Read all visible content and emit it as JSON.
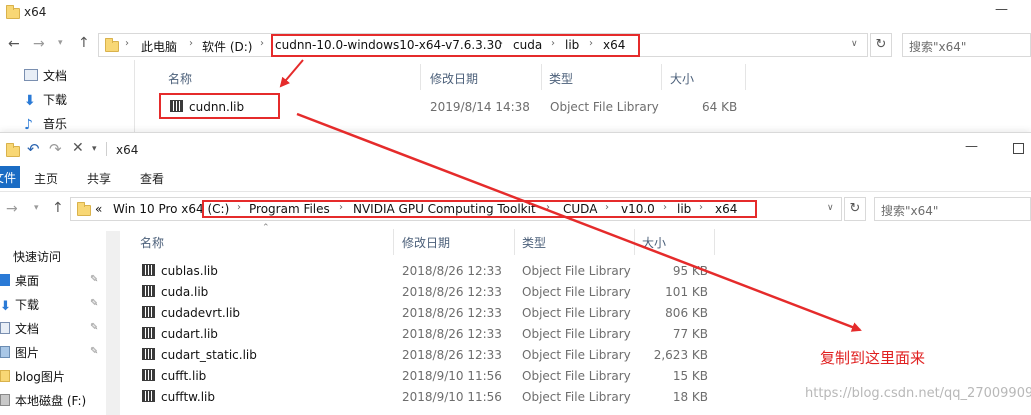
{
  "win1": {
    "title": "x64",
    "breadcrumbs": [
      "此电脑",
      "软件 (D:)",
      "cudnn-10.0-windows10-x64-v7.6.3.30",
      "cuda",
      "lib",
      "x64"
    ],
    "search_placeholder": "搜索\"x64\"",
    "sidebar": [
      {
        "label": "文档",
        "icon": "document-icon"
      },
      {
        "label": "下载",
        "icon": "download-arrow-icon"
      },
      {
        "label": "音乐",
        "icon": "music-note-icon"
      }
    ],
    "columns": {
      "name": "名称",
      "date": "修改日期",
      "type": "类型",
      "size": "大小"
    },
    "files": [
      {
        "name": "cudnn.lib",
        "date": "2019/8/14 14:38",
        "type": "Object File Library",
        "size": "64 KB"
      }
    ]
  },
  "win2": {
    "title": "x64",
    "ribbon": {
      "file": "文件",
      "home": "主页",
      "share": "共享",
      "view": "查看"
    },
    "breadcrumbs": [
      "«",
      "Win 10 Pro x64 (C:)",
      "Program Files",
      "NVIDIA GPU Computing Toolkit",
      "CUDA",
      "v10.0",
      "lib",
      "x64"
    ],
    "search_placeholder": "搜索\"x64\"",
    "sidebar": [
      {
        "label": "快速访问",
        "icon": "star-icon"
      },
      {
        "label": "桌面",
        "icon": "desktop-icon"
      },
      {
        "label": "下载",
        "icon": "download-arrow-icon"
      },
      {
        "label": "文档",
        "icon": "document-icon"
      },
      {
        "label": "图片",
        "icon": "picture-icon"
      },
      {
        "label": "blog图片",
        "icon": "folder-icon"
      },
      {
        "label": "本地磁盘 (F:)",
        "icon": "drive-icon"
      }
    ],
    "columns": {
      "name": "名称",
      "date": "修改日期",
      "type": "类型",
      "size": "大小"
    },
    "files": [
      {
        "name": "cublas.lib",
        "date": "2018/8/26 12:33",
        "type": "Object File Library",
        "size": "95 KB"
      },
      {
        "name": "cuda.lib",
        "date": "2018/8/26 12:33",
        "type": "Object File Library",
        "size": "101 KB"
      },
      {
        "name": "cudadevrt.lib",
        "date": "2018/8/26 12:33",
        "type": "Object File Library",
        "size": "806 KB"
      },
      {
        "name": "cudart.lib",
        "date": "2018/8/26 12:33",
        "type": "Object File Library",
        "size": "77 KB"
      },
      {
        "name": "cudart_static.lib",
        "date": "2018/8/26 12:33",
        "type": "Object File Library",
        "size": "2,623 KB"
      },
      {
        "name": "cufft.lib",
        "date": "2018/9/10 11:56",
        "type": "Object File Library",
        "size": "15 KB"
      },
      {
        "name": "cufftw.lib",
        "date": "2018/9/10 11:56",
        "type": "Object File Library",
        "size": "18 KB"
      }
    ]
  },
  "annotation": {
    "text": "复制到这里面来",
    "color": "#e52b2b"
  },
  "watermark": "https://blog.csdn.net/qq_27009909"
}
